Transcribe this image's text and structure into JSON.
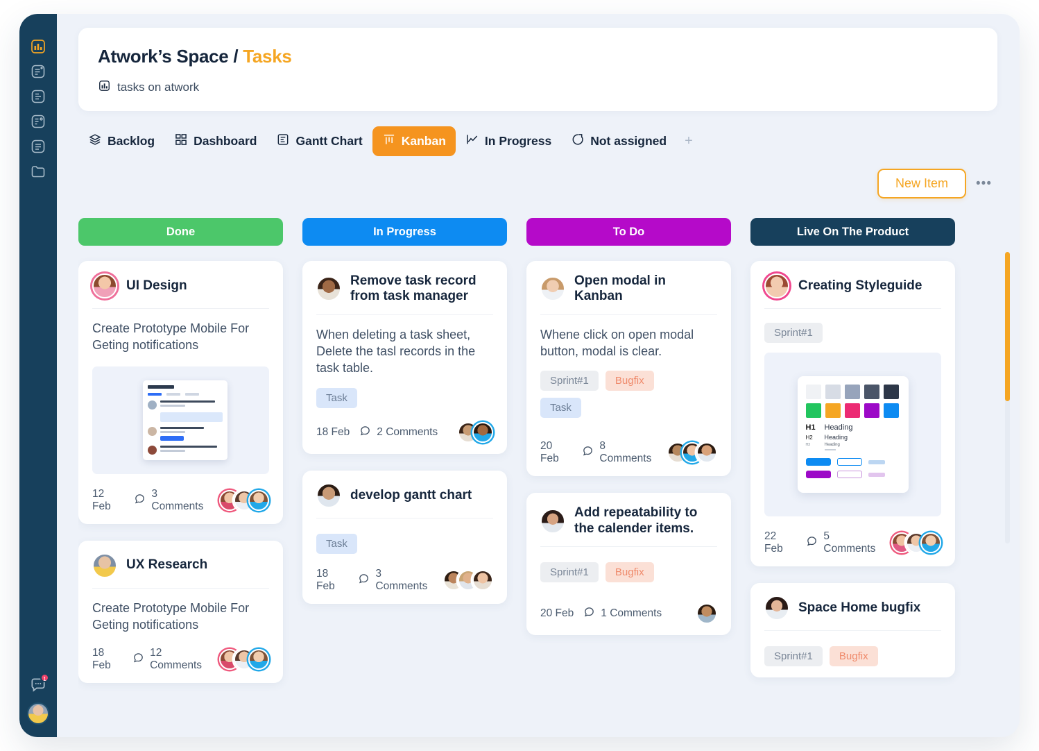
{
  "sidebar": {
    "items": [
      {
        "icon": "dashboard-icon",
        "active": true
      },
      {
        "icon": "note-icon",
        "active": false
      },
      {
        "icon": "document-icon",
        "active": false
      },
      {
        "icon": "tasks-icon",
        "active": false
      },
      {
        "icon": "list-icon",
        "active": false
      },
      {
        "icon": "folder-icon",
        "active": false
      }
    ],
    "chat_badge": "1"
  },
  "header": {
    "space_name": "Atwork’s Space",
    "separator": " / ",
    "page": "Tasks",
    "subtitle": "tasks on atwork",
    "subtitle_icon": "chart-icon",
    "accent_color": "#f5a623"
  },
  "tabs": [
    {
      "label": "Backlog",
      "icon": "layers-icon",
      "active": false
    },
    {
      "label": "Dashboard",
      "icon": "grid-icon",
      "active": false
    },
    {
      "label": "Gantt Chart",
      "icon": "gantt-icon",
      "active": false
    },
    {
      "label": "Kanban",
      "icon": "kanban-icon",
      "active": true
    },
    {
      "label": "In Progress",
      "icon": "chart-line-icon",
      "active": false
    },
    {
      "label": "Not assigned",
      "icon": "circle-slice-icon",
      "active": false
    }
  ],
  "tab_add_label": "+",
  "actions": {
    "new_item_label": "New Item",
    "more_label": "•••"
  },
  "board": {
    "columns": [
      {
        "title": "Done",
        "color": "#4cc76a",
        "cards": [
          {
            "title": "UI Design",
            "avatar_ring": "#ef6f9a",
            "avatar_colors": [
              "#f3c7a8",
              "#8c4a2f"
            ],
            "description": "Create Prototype Mobile For Geting notifications",
            "tags": [],
            "thumbnail": "notifications-mock",
            "date": "12 Feb",
            "comments": "3 Comments",
            "members": 3
          },
          {
            "title": "UX Research",
            "avatar_ring": "#8fa8c4",
            "avatar_colors": [
              "#e7c3a4",
              "#f2c94c"
            ],
            "description": "Create Prototype Mobile For Geting notifications",
            "tags": [],
            "thumbnail": null,
            "date": "18 Feb",
            "comments": "12 Comments",
            "members": 3
          }
        ]
      },
      {
        "title": "In Progress",
        "color": "#0d8bf2",
        "cards": [
          {
            "title": "Remove task record from task manager",
            "avatar_ring": "#ffffff",
            "avatar_colors": [
              "#a06a45",
              "#3b2418"
            ],
            "description": "When deleting a task sheet, Delete the tasl records in the task table.",
            "tags": [
              {
                "label": "Task",
                "style": "task"
              }
            ],
            "thumbnail": null,
            "date": "18 Feb",
            "comments": "2 Comments",
            "members": 2
          },
          {
            "title": "develop gantt chart",
            "avatar_ring": "#ffffff",
            "avatar_colors": [
              "#c89a76",
              "#2b1c14"
            ],
            "description": null,
            "tags": [
              {
                "label": "Task",
                "style": "task"
              }
            ],
            "thumbnail": null,
            "date": "18 Feb",
            "comments": "3 Comments",
            "members": 3
          }
        ]
      },
      {
        "title": "To Do",
        "color": "#b50ac9",
        "cards": [
          {
            "title": "Open modal in Kanban",
            "avatar_ring": "#ffffff",
            "avatar_colors": [
              "#f0cdb2",
              "#c89a6a"
            ],
            "description": "Whene click on open modal button, modal is clear.",
            "tags": [
              {
                "label": "Sprint#1",
                "style": "sprint"
              },
              {
                "label": "Bugfix",
                "style": "bugfix"
              },
              {
                "label": "Task",
                "style": "task"
              }
            ],
            "thumbnail": null,
            "date": "20 Feb",
            "comments": "8 Comments",
            "members": 3
          },
          {
            "title": "Add repeatability to the calender items.",
            "avatar_ring": "#ffffff",
            "avatar_colors": [
              "#d6a382",
              "#2b1c18"
            ],
            "description": null,
            "tags": [
              {
                "label": "Sprint#1",
                "style": "sprint"
              },
              {
                "label": "Bugfix",
                "style": "bugfix"
              }
            ],
            "thumbnail": null,
            "date": "20 Feb",
            "comments": "1 Comments",
            "members": 1
          }
        ]
      },
      {
        "title": "Live On The Product",
        "color": "#17405c",
        "cards": [
          {
            "title": "Creating Styleguide",
            "avatar_ring": "#f0478e",
            "avatar_colors": [
              "#f2cbb0",
              "#9b4a32"
            ],
            "description": null,
            "tags": [
              {
                "label": "Sprint#1",
                "style": "sprint"
              }
            ],
            "thumbnail": "styleguide-mock",
            "date": "22 Feb",
            "comments": "5 Comments",
            "members": 3
          },
          {
            "title": "Space Home bugfix",
            "avatar_ring": "#ffffff",
            "avatar_colors": [
              "#e4b698",
              "#2a1a16"
            ],
            "description": null,
            "tags": [
              {
                "label": "Sprint#1",
                "style": "sprint"
              },
              {
                "label": "Bugfix",
                "style": "bugfix"
              }
            ],
            "thumbnail": null,
            "date": null,
            "comments": null,
            "members": 0
          }
        ]
      }
    ]
  },
  "styleguide_mock": {
    "swatches_row1": [
      "#f0f2f5",
      "#d7dce5",
      "#97a4bb",
      "#4a5568",
      "#2d3748"
    ],
    "swatches_row2": [
      "#22c55e",
      "#f5a623",
      "#ec2a73",
      "#9c09c7",
      "#0d8bf2"
    ],
    "type_rows": [
      {
        "level": "H1",
        "text": "Heading"
      },
      {
        "level": "H2",
        "text": "Heading"
      },
      {
        "level": "H3",
        "text": "Heading"
      }
    ],
    "button_colors": [
      "#0d8bf2",
      "#9c09c7"
    ]
  }
}
